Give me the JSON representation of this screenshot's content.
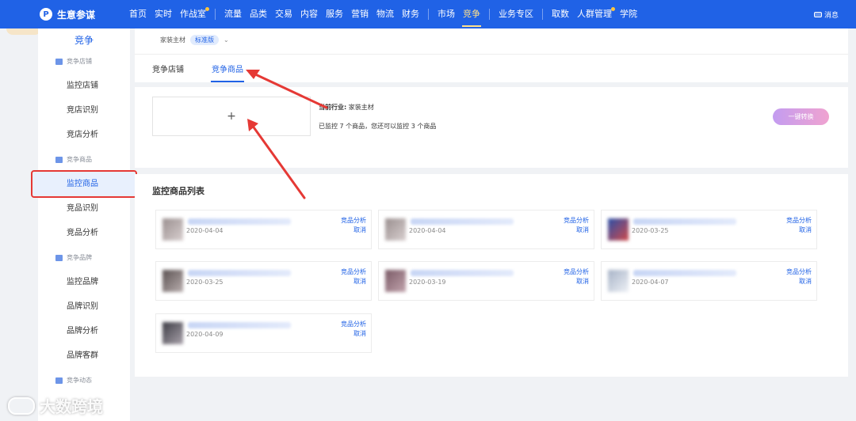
{
  "topbar": {
    "brand_name": "生意参谋",
    "brand_logo": "P",
    "nav_main": [
      "首页",
      "实时",
      "作战室",
      "流量",
      "品类",
      "交易",
      "内容",
      "服务",
      "营销",
      "物流",
      "财务",
      "市场",
      "竞争",
      "业务专区",
      "取数",
      "人群管理",
      "学院"
    ],
    "active": "竞争",
    "message": "消息"
  },
  "sidebar": {
    "title": "竞争",
    "groups": [
      {
        "label": "竞争店铺",
        "items": [
          "监控店铺",
          "竞店识别",
          "竞店分析"
        ]
      },
      {
        "label": "竞争商品",
        "items": [
          "监控商品",
          "竞品识别",
          "竞品分析"
        ]
      },
      {
        "label": "竞争品牌",
        "items": [
          "监控品牌",
          "品牌识别",
          "品牌分析",
          "品牌客群"
        ]
      },
      {
        "label": "竞争动态",
        "items": []
      }
    ]
  },
  "header": {
    "category": "家装主材",
    "edition_badge": "标准版",
    "tabs": [
      "竞争店铺",
      "竞争商品"
    ],
    "active_tab": "竞争商品"
  },
  "add_panel": {
    "add_symbol": "+",
    "industry_label": "当前行业:",
    "industry_value": "家装主材",
    "monitor_note": "已监控 7 个商品，您还可以监控 3 个商品",
    "convert_button": "一键转换"
  },
  "list": {
    "title": "监控商品列表",
    "analyze_label": "竞品分析",
    "cancel_label": "取消",
    "dates": [
      "2020-04-04",
      "2020-04-04",
      "2020-03-25",
      "2020-03-25",
      "2020-03-19",
      "2020-04-07",
      "2020-04-09"
    ]
  },
  "watermark": "大数跨境",
  "colors": {
    "primary": "#2062e6",
    "highlight_border": "#e53935",
    "arrow": "#e53935"
  }
}
